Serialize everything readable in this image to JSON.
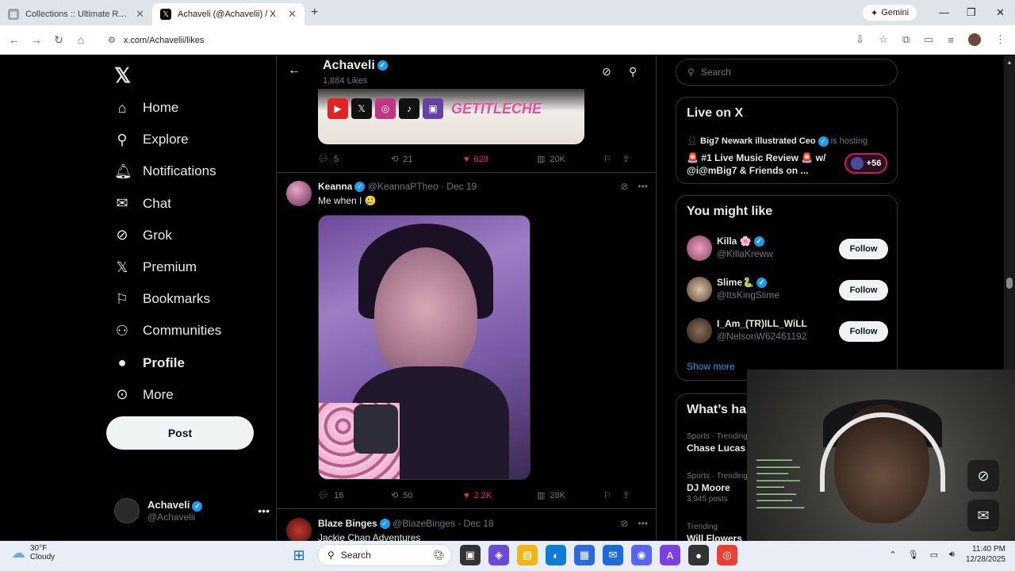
{
  "browser": {
    "tabs": [
      {
        "title": "Collections :: Ultimate Rap League",
        "active": false
      },
      {
        "title": "Achaveli (@Achavelii) / X",
        "active": true
      }
    ],
    "gemini": "Gemini",
    "url": "x.com/Achavelii/likes"
  },
  "nav": {
    "items": [
      {
        "label": "Home",
        "icon": "home-icon"
      },
      {
        "label": "Explore",
        "icon": "search-icon"
      },
      {
        "label": "Notifications",
        "icon": "bell-icon"
      },
      {
        "label": "Chat",
        "icon": "mail-icon"
      },
      {
        "label": "Grok",
        "icon": "grok-icon"
      },
      {
        "label": "Premium",
        "icon": "x-logo-icon"
      },
      {
        "label": "Bookmarks",
        "icon": "bookmark-icon"
      },
      {
        "label": "Communities",
        "icon": "people-icon"
      },
      {
        "label": "Profile",
        "icon": "person-icon"
      },
      {
        "label": "More",
        "icon": "more-circle-icon"
      }
    ],
    "post_label": "Post",
    "account": {
      "name": "Achaveli",
      "handle": "@Achavelii"
    }
  },
  "header": {
    "title": "Achaveli",
    "subtitle": "1,884 Likes"
  },
  "tweet1": {
    "media_text": "GETITLECHE",
    "replies": "5",
    "reposts": "21",
    "likes": "628",
    "views": "20K"
  },
  "tweet2": {
    "name": "Keanna",
    "handle": "@KeannaPTheo",
    "date": "· Dec 19",
    "text": "Me when I 🥲",
    "replies": "16",
    "reposts": "50",
    "likes": "2.2K",
    "views": "28K"
  },
  "tweet3": {
    "name": "Blaze Binges",
    "handle": "@BlazeBinges",
    "date": "· Dec 18",
    "text": "Jackie Chan Adventures"
  },
  "right": {
    "search_placeholder": "Search",
    "live": {
      "title": "Live on X",
      "host_name": "Big7 Newark illustrated Ceo",
      "host_suffix": "is hosting",
      "stream_title": "🚨 #1 Live Music Review 🚨 w/ @i@mBig7 & Friends on ...",
      "count": "+56"
    },
    "might_like": {
      "title": "You might like",
      "users": [
        {
          "name": "Killa 🌸",
          "handle": "@KillaKreww",
          "button": "Follow"
        },
        {
          "name": "Slime🐍",
          "handle": "@ItsKingSlime",
          "button": "Follow"
        },
        {
          "name": "I_Am_(TR)ILL_WiLL",
          "handle": "@NelsonW62461192",
          "button": "Follow"
        }
      ],
      "show_more": "Show more"
    },
    "happening": {
      "title": "What’s happening",
      "trends": [
        {
          "category": "Sports · Trending",
          "name": "Chase Lucas",
          "count": ""
        },
        {
          "category": "Sports · Trending",
          "name": "DJ Moore",
          "count": "3,945 posts"
        },
        {
          "category": "Trending",
          "name": "Will Flowers",
          "count": ""
        }
      ]
    }
  },
  "taskbar": {
    "temp": "30°F",
    "condition": "Cloudy",
    "search": "Search",
    "time": "11:40 PM",
    "date": "12/28/2025"
  },
  "colors": {
    "accent": "#1d9bf0",
    "like": "#f91880",
    "bg": "#000000",
    "border": "#2f3336"
  }
}
